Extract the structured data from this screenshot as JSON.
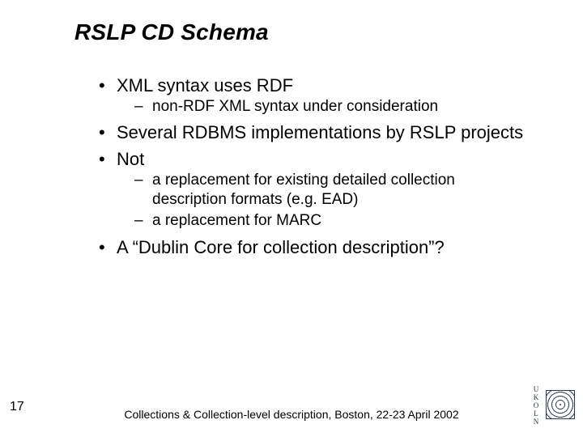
{
  "title": "RSLP CD Schema",
  "bullets": {
    "b1": "XML syntax uses RDF",
    "b1_sub1": "non-RDF XML syntax under consideration",
    "b2": "Several RDBMS implementations by RSLP projects",
    "b3": "Not",
    "b3_sub1": "a replacement for existing detailed collection description formats (e.g. EAD)",
    "b3_sub2": "a replacement for MARC",
    "b4": "A “Dublin Core for collection description”?"
  },
  "page_number": "17",
  "footer": "Collections & Collection-level description, Boston, 22-23 April 2002",
  "logo_text": "UKOLN"
}
